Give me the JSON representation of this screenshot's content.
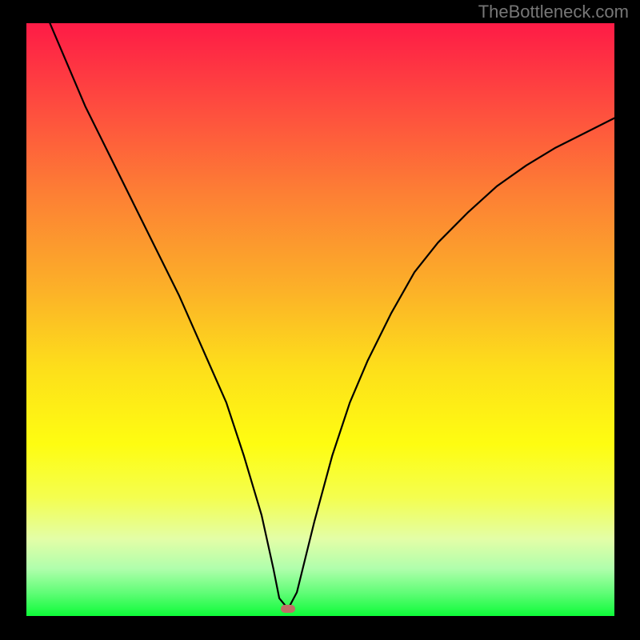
{
  "watermark": "TheBottleneck.com",
  "chart_data": {
    "type": "line",
    "title": "",
    "xlabel": "",
    "ylabel": "",
    "xlim": [
      0,
      100
    ],
    "ylim": [
      0,
      100
    ],
    "series": [
      {
        "name": "curve",
        "x": [
          4,
          7,
          10,
          14,
          18,
          22,
          26,
          30,
          34,
          37,
          40,
          42,
          43,
          44.5,
          46,
          49,
          52,
          55,
          58,
          62,
          66,
          70,
          75,
          80,
          85,
          90,
          95,
          100
        ],
        "y": [
          100,
          93,
          86,
          78,
          70,
          62,
          54,
          45,
          36,
          27,
          17,
          8,
          3,
          1.2,
          4,
          16,
          27,
          36,
          43,
          51,
          58,
          63,
          68,
          72.5,
          76,
          79,
          81.5,
          84
        ]
      }
    ],
    "marker": {
      "x": 44.5,
      "y": 1.2,
      "w_pct": 2.5,
      "h_pct": 1.4
    },
    "gradient_stops": [
      {
        "pos": 0,
        "color": "#fe1b46"
      },
      {
        "pos": 14,
        "color": "#fe4c3f"
      },
      {
        "pos": 29,
        "color": "#fd8034"
      },
      {
        "pos": 45,
        "color": "#fcb128"
      },
      {
        "pos": 58,
        "color": "#fdde1b"
      },
      {
        "pos": 71,
        "color": "#fefd11"
      },
      {
        "pos": 80,
        "color": "#f4fe4f"
      },
      {
        "pos": 87,
        "color": "#e3fea7"
      },
      {
        "pos": 92,
        "color": "#b0feac"
      },
      {
        "pos": 96,
        "color": "#62fd78"
      },
      {
        "pos": 100,
        "color": "#0efb39"
      }
    ]
  }
}
